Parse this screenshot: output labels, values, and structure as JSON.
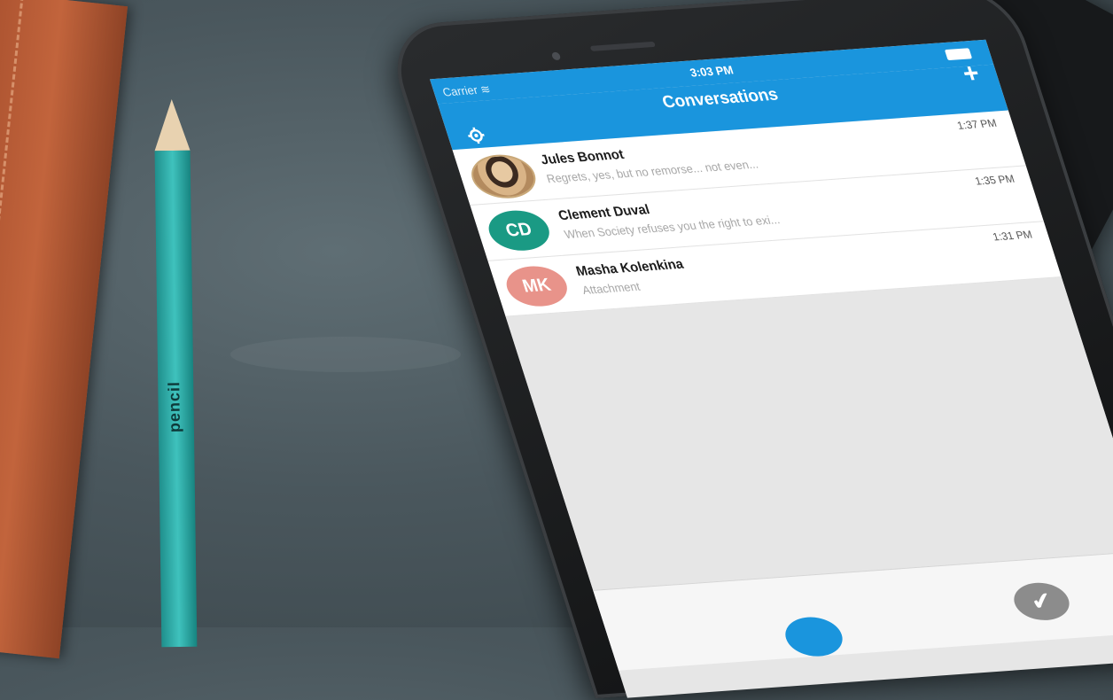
{
  "status_bar": {
    "carrier": "Carrier",
    "time": "3:03 PM"
  },
  "nav_bar": {
    "title": "Conversations",
    "add_symbol": "+"
  },
  "conversations": [
    {
      "name": "Jules Bonnot",
      "preview": "Regrets, yes, but no remorse... not even...",
      "time": "1:37 PM",
      "avatar_initials": "",
      "avatar_color": "#c9a878"
    },
    {
      "name": "Clement Duval",
      "preview": "When Society refuses you the right to exi...",
      "time": "1:35 PM",
      "avatar_initials": "CD",
      "avatar_color": "#1a9a84"
    },
    {
      "name": "Masha Kolenkina",
      "preview": "Attachment",
      "time": "1:31 PM",
      "avatar_initials": "MK",
      "avatar_color": "#e8938a"
    }
  ],
  "tab_bar": {
    "check_symbol": "✔"
  },
  "pencil": {
    "brand": "pencil"
  },
  "colors": {
    "accent": "#1a95dd",
    "background": "#4a575d"
  },
  "icons": [
    "settings-gear-icon",
    "plus-icon",
    "wifi-icon",
    "battery-icon",
    "checkmark-icon"
  ]
}
